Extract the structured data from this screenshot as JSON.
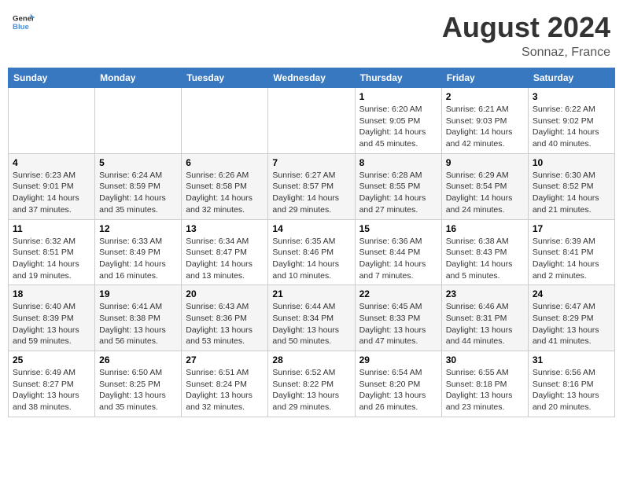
{
  "header": {
    "logo_general": "General",
    "logo_blue": "Blue",
    "month_year": "August 2024",
    "location": "Sonnaz, France"
  },
  "days_of_week": [
    "Sunday",
    "Monday",
    "Tuesday",
    "Wednesday",
    "Thursday",
    "Friday",
    "Saturday"
  ],
  "weeks": [
    [
      {
        "day": "",
        "info": ""
      },
      {
        "day": "",
        "info": ""
      },
      {
        "day": "",
        "info": ""
      },
      {
        "day": "",
        "info": ""
      },
      {
        "day": "1",
        "info": "Sunrise: 6:20 AM\nSunset: 9:05 PM\nDaylight: 14 hours\nand 45 minutes."
      },
      {
        "day": "2",
        "info": "Sunrise: 6:21 AM\nSunset: 9:03 PM\nDaylight: 14 hours\nand 42 minutes."
      },
      {
        "day": "3",
        "info": "Sunrise: 6:22 AM\nSunset: 9:02 PM\nDaylight: 14 hours\nand 40 minutes."
      }
    ],
    [
      {
        "day": "4",
        "info": "Sunrise: 6:23 AM\nSunset: 9:01 PM\nDaylight: 14 hours\nand 37 minutes."
      },
      {
        "day": "5",
        "info": "Sunrise: 6:24 AM\nSunset: 8:59 PM\nDaylight: 14 hours\nand 35 minutes."
      },
      {
        "day": "6",
        "info": "Sunrise: 6:26 AM\nSunset: 8:58 PM\nDaylight: 14 hours\nand 32 minutes."
      },
      {
        "day": "7",
        "info": "Sunrise: 6:27 AM\nSunset: 8:57 PM\nDaylight: 14 hours\nand 29 minutes."
      },
      {
        "day": "8",
        "info": "Sunrise: 6:28 AM\nSunset: 8:55 PM\nDaylight: 14 hours\nand 27 minutes."
      },
      {
        "day": "9",
        "info": "Sunrise: 6:29 AM\nSunset: 8:54 PM\nDaylight: 14 hours\nand 24 minutes."
      },
      {
        "day": "10",
        "info": "Sunrise: 6:30 AM\nSunset: 8:52 PM\nDaylight: 14 hours\nand 21 minutes."
      }
    ],
    [
      {
        "day": "11",
        "info": "Sunrise: 6:32 AM\nSunset: 8:51 PM\nDaylight: 14 hours\nand 19 minutes."
      },
      {
        "day": "12",
        "info": "Sunrise: 6:33 AM\nSunset: 8:49 PM\nDaylight: 14 hours\nand 16 minutes."
      },
      {
        "day": "13",
        "info": "Sunrise: 6:34 AM\nSunset: 8:47 PM\nDaylight: 14 hours\nand 13 minutes."
      },
      {
        "day": "14",
        "info": "Sunrise: 6:35 AM\nSunset: 8:46 PM\nDaylight: 14 hours\nand 10 minutes."
      },
      {
        "day": "15",
        "info": "Sunrise: 6:36 AM\nSunset: 8:44 PM\nDaylight: 14 hours\nand 7 minutes."
      },
      {
        "day": "16",
        "info": "Sunrise: 6:38 AM\nSunset: 8:43 PM\nDaylight: 14 hours\nand 5 minutes."
      },
      {
        "day": "17",
        "info": "Sunrise: 6:39 AM\nSunset: 8:41 PM\nDaylight: 14 hours\nand 2 minutes."
      }
    ],
    [
      {
        "day": "18",
        "info": "Sunrise: 6:40 AM\nSunset: 8:39 PM\nDaylight: 13 hours\nand 59 minutes."
      },
      {
        "day": "19",
        "info": "Sunrise: 6:41 AM\nSunset: 8:38 PM\nDaylight: 13 hours\nand 56 minutes."
      },
      {
        "day": "20",
        "info": "Sunrise: 6:43 AM\nSunset: 8:36 PM\nDaylight: 13 hours\nand 53 minutes."
      },
      {
        "day": "21",
        "info": "Sunrise: 6:44 AM\nSunset: 8:34 PM\nDaylight: 13 hours\nand 50 minutes."
      },
      {
        "day": "22",
        "info": "Sunrise: 6:45 AM\nSunset: 8:33 PM\nDaylight: 13 hours\nand 47 minutes."
      },
      {
        "day": "23",
        "info": "Sunrise: 6:46 AM\nSunset: 8:31 PM\nDaylight: 13 hours\nand 44 minutes."
      },
      {
        "day": "24",
        "info": "Sunrise: 6:47 AM\nSunset: 8:29 PM\nDaylight: 13 hours\nand 41 minutes."
      }
    ],
    [
      {
        "day": "25",
        "info": "Sunrise: 6:49 AM\nSunset: 8:27 PM\nDaylight: 13 hours\nand 38 minutes."
      },
      {
        "day": "26",
        "info": "Sunrise: 6:50 AM\nSunset: 8:25 PM\nDaylight: 13 hours\nand 35 minutes."
      },
      {
        "day": "27",
        "info": "Sunrise: 6:51 AM\nSunset: 8:24 PM\nDaylight: 13 hours\nand 32 minutes."
      },
      {
        "day": "28",
        "info": "Sunrise: 6:52 AM\nSunset: 8:22 PM\nDaylight: 13 hours\nand 29 minutes."
      },
      {
        "day": "29",
        "info": "Sunrise: 6:54 AM\nSunset: 8:20 PM\nDaylight: 13 hours\nand 26 minutes."
      },
      {
        "day": "30",
        "info": "Sunrise: 6:55 AM\nSunset: 8:18 PM\nDaylight: 13 hours\nand 23 minutes."
      },
      {
        "day": "31",
        "info": "Sunrise: 6:56 AM\nSunset: 8:16 PM\nDaylight: 13 hours\nand 20 minutes."
      }
    ]
  ]
}
